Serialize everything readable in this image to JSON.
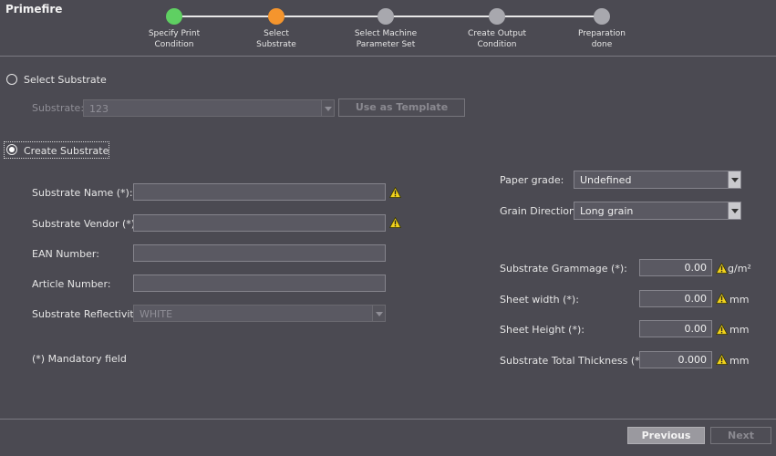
{
  "app": {
    "title": "Primefire"
  },
  "steps": [
    {
      "line1": "Specify Print",
      "line2": "Condition",
      "state": "done",
      "color": "#5fd062"
    },
    {
      "line1": "Select",
      "line2": "Substrate",
      "state": "current",
      "color": "#f5952d"
    },
    {
      "line1": "Select Machine",
      "line2": "Parameter Set",
      "state": "pending",
      "color": "#a8a8ae"
    },
    {
      "line1": "Create Output",
      "line2": "Condition",
      "state": "pending",
      "color": "#a8a8ae"
    },
    {
      "line1": "Preparation",
      "line2": "done",
      "state": "pending",
      "color": "#a8a8ae"
    }
  ],
  "select_substrate": {
    "radio_label": "Select Substrate",
    "substrate_label": "Substrate:",
    "substrate_value": "123",
    "template_button": "Use as Template"
  },
  "create_substrate": {
    "radio_label": "Create Substrate",
    "name_label": "Substrate Name (*):",
    "name_value": "",
    "vendor_label": "Substrate Vendor (*):",
    "vendor_value": "",
    "ean_label": "EAN Number:",
    "ean_value": "",
    "article_label": "Article Number:",
    "article_value": "",
    "reflectivity_label": "Substrate Reflectivity:",
    "reflectivity_value": "WHITE",
    "mandatory_note": "(*) Mandatory field",
    "paper_grade_label": "Paper grade:",
    "paper_grade_value": "Undefined",
    "grain_label": "Grain Direction:",
    "grain_value": "Long grain",
    "grammage_label": "Substrate Grammage (*):",
    "grammage_value": "0.00",
    "grammage_unit": "g/m²",
    "width_label": "Sheet width (*):",
    "width_value": "0.00",
    "width_unit": "mm",
    "height_label": "Sheet Height (*):",
    "height_value": "0.00",
    "height_unit": "mm",
    "thickness_label": "Substrate Total Thickness (*):",
    "thickness_value": "0.000",
    "thickness_unit": "mm"
  },
  "footer": {
    "previous": "Previous",
    "next": "Next"
  },
  "colors": {
    "background": "#4b4a52",
    "warning": "#f2d21c",
    "step_done": "#5fd062",
    "step_current": "#f5952d",
    "step_pending": "#a8a8ae"
  }
}
